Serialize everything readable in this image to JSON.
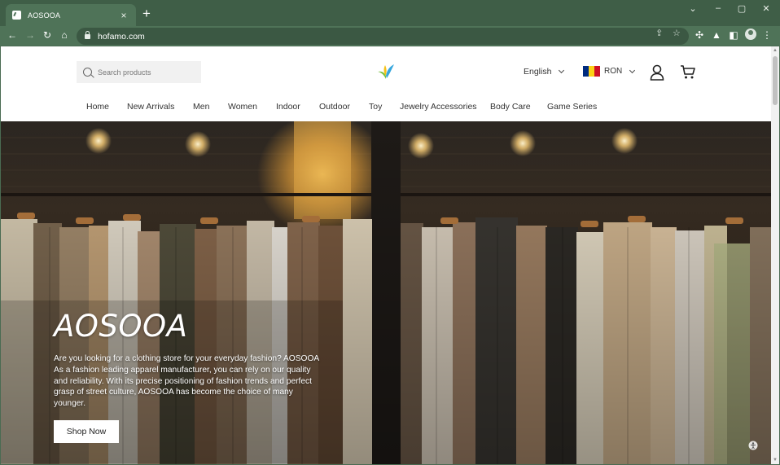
{
  "browser": {
    "tab_title": "AOSOOA",
    "url": "hofamo.com",
    "new_tab_label": "+",
    "close_tab_label": "×"
  },
  "header": {
    "search_placeholder": "Search products",
    "language": "English",
    "currency": "RON",
    "flag_colors": [
      "#002B7F",
      "#FCD116",
      "#CE1126"
    ]
  },
  "nav": {
    "items": [
      "Home",
      "New Arrivals",
      "Men",
      "Women",
      "Indoor",
      "Outdoor",
      "Toy",
      "Jewelry Accessories",
      "Body Care",
      "Game Series"
    ]
  },
  "hero": {
    "title": "AOSOOA",
    "description": "Are you looking for a clothing store for your everyday fashion? AOSOOA As a fashion leading apparel manufacturer, you can rely on our quality and reliability. With its precise positioning of fashion trends and perfect grasp of street culture, AOSOOA has become the choice of many younger.",
    "button_label": "Shop Now"
  },
  "colors": {
    "chrome_dark": "#3f5e47",
    "chrome": "#4f7358",
    "logo_green": "#7ac142",
    "logo_yellow": "#f5c21b",
    "logo_blue": "#35a6dd"
  }
}
